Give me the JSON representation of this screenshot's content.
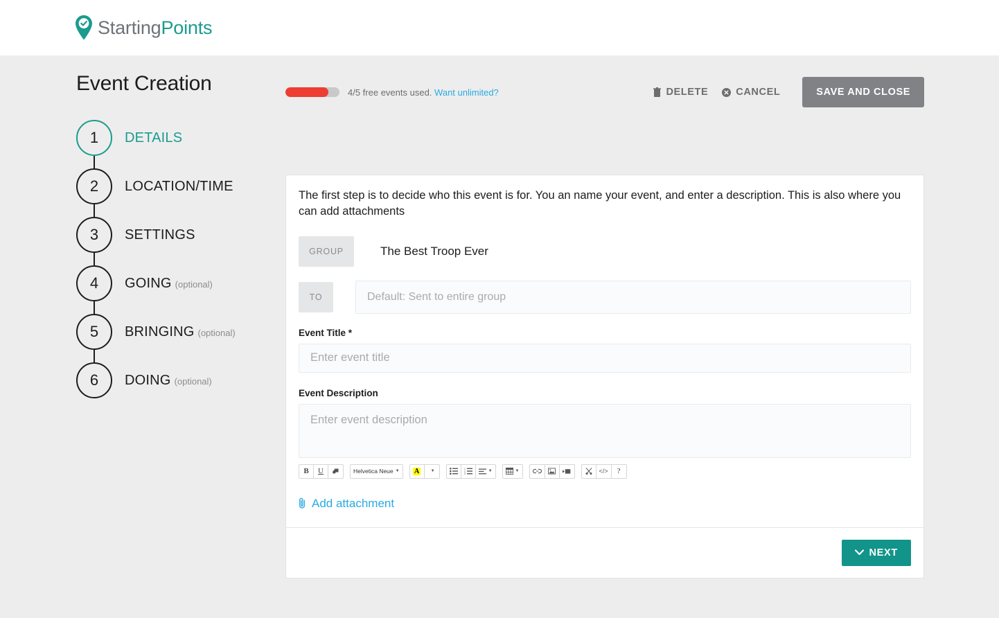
{
  "brand": {
    "name_part1": "Starting",
    "name_part2": "Points",
    "logo_icon": "map-pin-check-icon",
    "teal": "#1b9b8e"
  },
  "page": {
    "title": "Event Creation"
  },
  "usage": {
    "progress_percent": 80,
    "text": "4/5 free events used.",
    "link_label": "Want unlimited?",
    "bar_color": "#ee3e33",
    "track_color": "#c9c9c9",
    "link_color": "#29abe2"
  },
  "actions": {
    "delete_label": "DELETE",
    "delete_icon": "trash-icon",
    "cancel_label": "CANCEL",
    "cancel_icon": "circle-x-icon",
    "save_label": "SAVE AND CLOSE",
    "save_color": "#808285"
  },
  "steps": [
    {
      "number": "1",
      "label": "DETAILS",
      "optional": "",
      "active": true
    },
    {
      "number": "2",
      "label": "LOCATION/TIME",
      "optional": "",
      "active": false
    },
    {
      "number": "3",
      "label": "SETTINGS",
      "optional": "",
      "active": false
    },
    {
      "number": "4",
      "label": "GOING",
      "optional": "(optional)",
      "active": false
    },
    {
      "number": "5",
      "label": "BRINGING",
      "optional": "(optional)",
      "active": false
    },
    {
      "number": "6",
      "label": "DOING",
      "optional": "(optional)",
      "active": false
    }
  ],
  "form": {
    "intro": "The first step is to decide who this event is for. You an name your event, and enter a description. This is also where you can add attachments",
    "group_label": "GROUP",
    "group_value": "The Best Troop Ever",
    "to_label": "TO",
    "to_placeholder": "Default: Sent to entire group",
    "to_value": "",
    "title_label": "Event Title *",
    "title_placeholder": "Enter event title",
    "title_value": "",
    "description_label": "Event Description",
    "description_placeholder": "Enter event description",
    "description_value": "",
    "attachment_label": "Add attachment",
    "attachment_icon": "paperclip-icon"
  },
  "editor_toolbar": {
    "bold": "B",
    "underline": "U",
    "clear_format_icon": "eraser-icon",
    "font_name": "Helvetica Neue",
    "highlight_letter": "A",
    "bullet_list_icon": "unordered-list-icon",
    "numbered_list_icon": "ordered-list-icon",
    "align_icon": "align-left-icon",
    "table_icon": "table-icon",
    "link_icon": "link-icon",
    "image_icon": "image-icon",
    "video_icon": "video-icon",
    "cut_icon": "scissors-icon",
    "code_label": "</>",
    "help_label": "?"
  },
  "footer": {
    "next_label": "NEXT",
    "next_icon": "chevron-down-icon",
    "next_color": "#12948a"
  }
}
